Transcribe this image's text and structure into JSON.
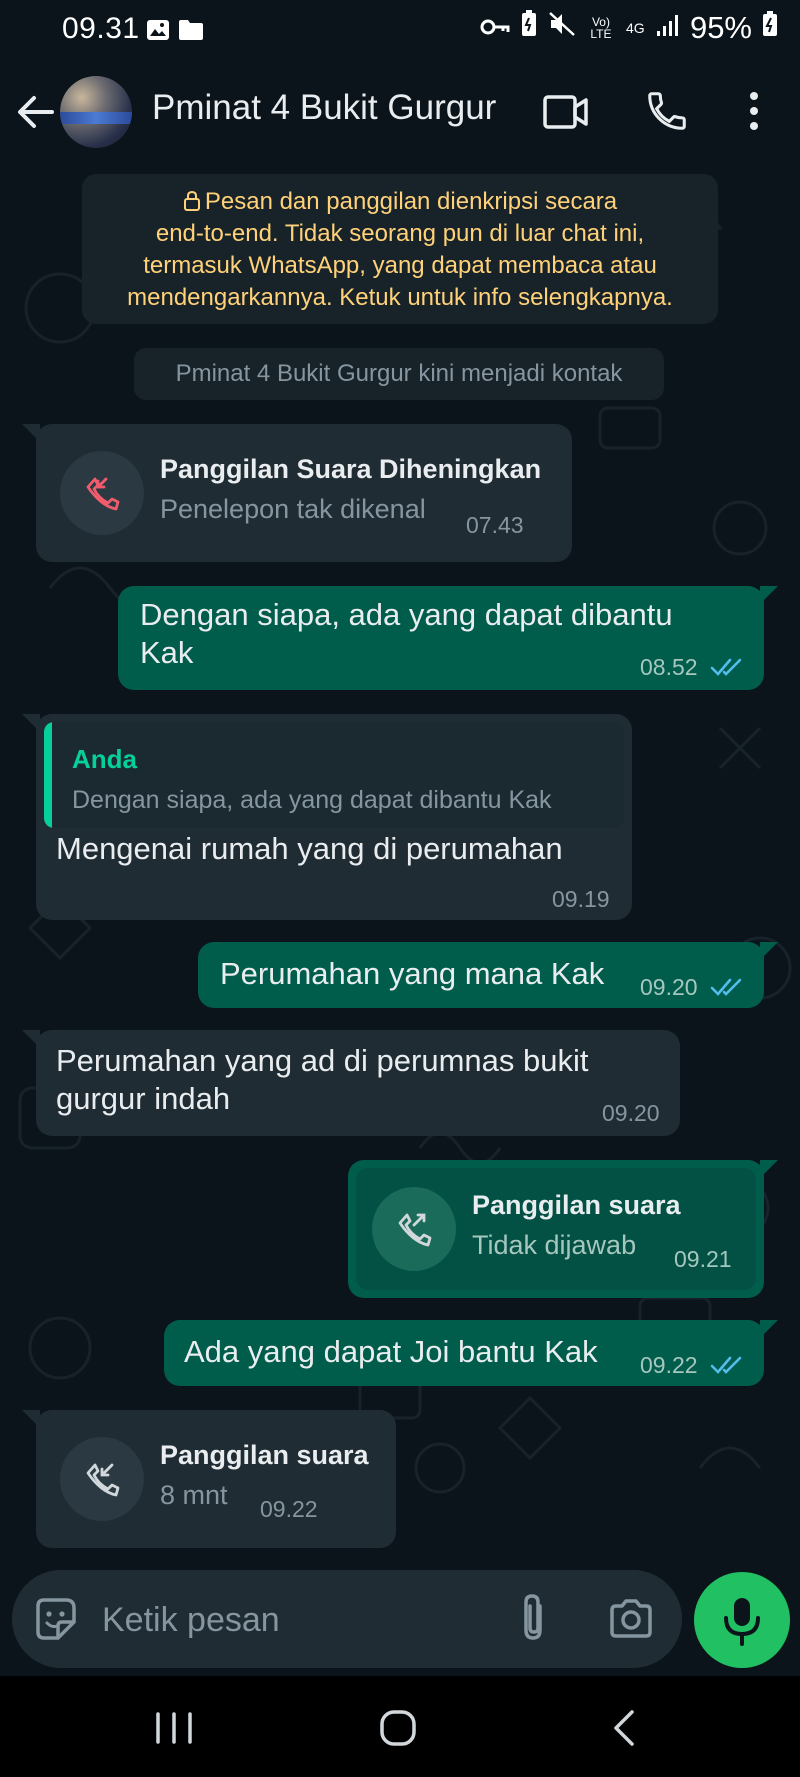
{
  "status_bar": {
    "time": "09.31",
    "battery": "95%",
    "lte_label": "Vo) LTE",
    "network_label": "4G",
    "icons": [
      "gallery-icon",
      "folder-icon",
      "key-icon",
      "battery-saver-icon",
      "mute-icon",
      "volte-icon",
      "4g-icon",
      "signal-icon",
      "battery-icon"
    ]
  },
  "header": {
    "title": "Pminat 4 Bukit Gurgur",
    "icons": [
      "back-arrow-icon",
      "video-call-icon",
      "phone-icon",
      "more-vert-icon"
    ]
  },
  "encryption_notice": {
    "line1": "Pesan dan panggilan dienkripsi secara",
    "line2": "end-to-end. Tidak seorang pun di luar chat ini,",
    "line3": "termasuk WhatsApp, yang dapat membaca atau",
    "line4": "mendengarkannya. Ketuk untuk info selengkapnya."
  },
  "system_note": "Pminat 4 Bukit Gurgur kini menjadi kontak",
  "messages": [
    {
      "type": "call",
      "direction": "in",
      "title": "Panggilan Suara Diheningkan",
      "subtitle": "Penelepon tak dikenal",
      "time": "07.43",
      "icon": "missed-call-icon"
    },
    {
      "type": "text",
      "direction": "out",
      "line1": "Dengan siapa, ada yang dapat dibantu",
      "line2": "Kak",
      "time": "08.52",
      "status": "read"
    },
    {
      "type": "reply",
      "direction": "in",
      "quote_author": "Anda",
      "quote_text": "Dengan siapa, ada yang dapat dibantu Kak",
      "text": "Mengenai rumah yang di perumahan",
      "time": "09.19"
    },
    {
      "type": "text",
      "direction": "out",
      "text": "Perumahan yang mana Kak",
      "time": "09.20",
      "status": "read"
    },
    {
      "type": "text",
      "direction": "in",
      "line1": "Perumahan yang ad di perumnas bukit",
      "line2": "gurgur indah",
      "time": "09.20"
    },
    {
      "type": "call",
      "direction": "out",
      "title": "Panggilan suara",
      "subtitle": "Tidak dijawab",
      "time": "09.21",
      "icon": "outgoing-call-icon"
    },
    {
      "type": "text",
      "direction": "out",
      "text": "Ada yang dapat Joi bantu Kak",
      "time": "09.22",
      "status": "read"
    },
    {
      "type": "call",
      "direction": "in",
      "title": "Panggilan suara",
      "subtitle": "8 mnt",
      "time": "09.22",
      "icon": "incoming-call-icon"
    }
  ],
  "composer": {
    "placeholder": "Ketik pesan",
    "icons": [
      "sticker-icon",
      "attach-icon",
      "camera-icon",
      "mic-icon"
    ]
  },
  "colors": {
    "background": "#0b141a",
    "incoming_bubble": "#202c33",
    "outgoing_bubble": "#005c4b",
    "accent_green": "#21c063",
    "notice_text": "#ffd279",
    "read_ticks": "#53bdeb",
    "missed_call_red": "#f15c6d"
  }
}
